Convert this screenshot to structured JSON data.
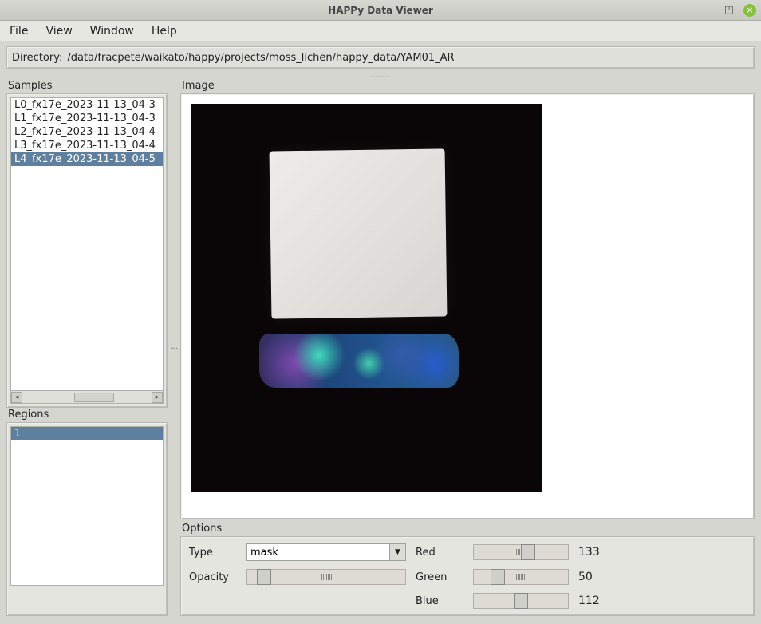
{
  "window": {
    "title": "HAPPy Data Viewer"
  },
  "menu": {
    "file": "File",
    "view": "View",
    "window": "Window",
    "help": "Help"
  },
  "directory": {
    "label": "Directory:",
    "path": "/data/fracpete/waikato/happy/projects/moss_lichen/happy_data/YAM01_AR"
  },
  "samples": {
    "label": "Samples",
    "items": [
      "L0_fx17e_2023-11-13_04-3",
      "L1_fx17e_2023-11-13_04-3",
      "L2_fx17e_2023-11-13_04-4",
      "L3_fx17e_2023-11-13_04-4",
      "L4_fx17e_2023-11-13_04-5"
    ],
    "selected_index": 4
  },
  "regions": {
    "label": "Regions",
    "items": [
      "1"
    ],
    "selected_index": 0
  },
  "image": {
    "label": "Image"
  },
  "options": {
    "label": "Options",
    "type_label": "Type",
    "type_value": "mask",
    "opacity_label": "Opacity",
    "opacity_value": 10,
    "red_label": "Red",
    "red_value": "133",
    "green_label": "Green",
    "green_value": "50",
    "blue_label": "Blue",
    "blue_value": "112"
  }
}
